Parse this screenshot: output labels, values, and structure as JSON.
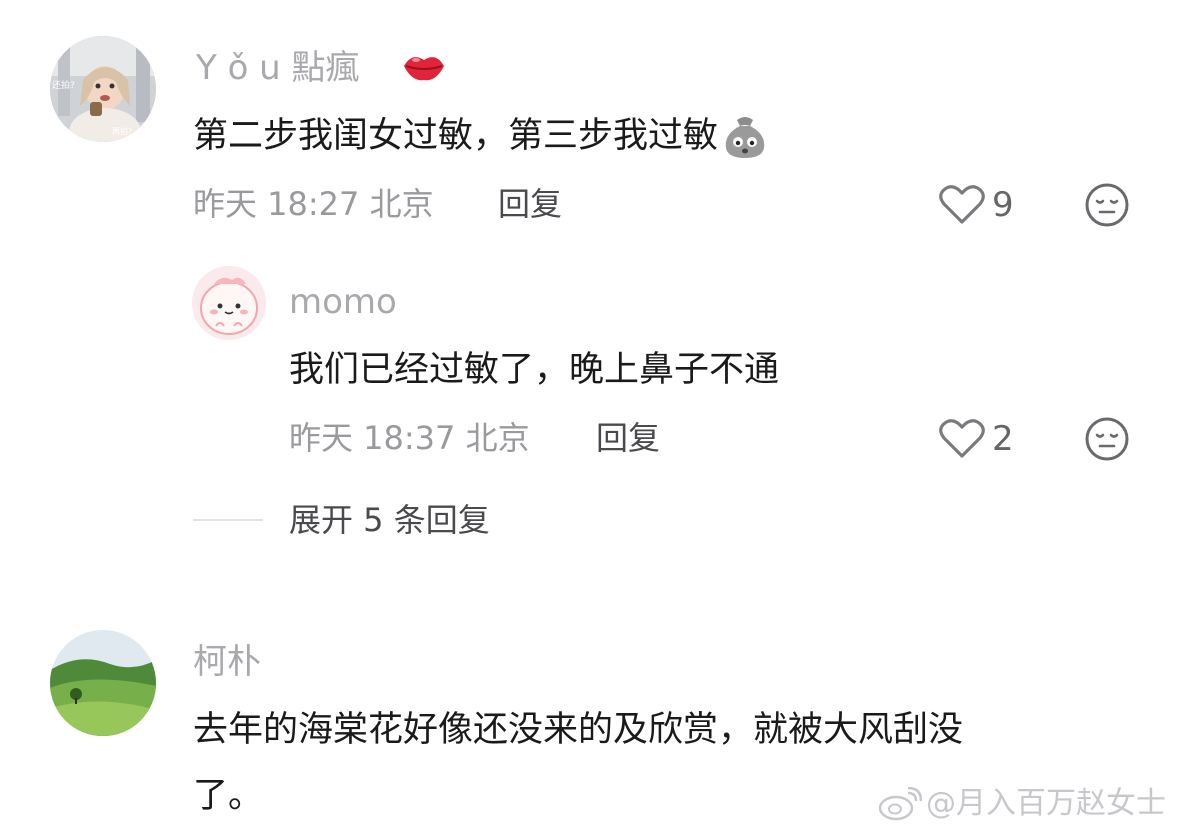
{
  "comments": [
    {
      "username": "Y ǒ u 點瘋",
      "badge_icon": "lips-emoji-icon",
      "text": "第二步我闺女过敏，第三步我过敏",
      "trailing_emoji": "money-bag-face-emoji-icon",
      "meta": "昨天 18:27 北京",
      "reply_label": "回复",
      "likes": "9",
      "accent": "#e0253a"
    },
    {
      "username": "momo",
      "text": "我们已经过敏了，晚上鼻子不通",
      "meta": "昨天 18:37 北京",
      "reply_label": "回复",
      "likes": "2"
    },
    {
      "username": "柯朴",
      "text_line1": "去年的海棠花好像还没来的及欣赏，就被大风刮没",
      "text_line2": "了。"
    }
  ],
  "expand_replies": "展开 5 条回复",
  "watermark": "@月入百万赵女士",
  "icons": [
    "heart-outline-icon",
    "dislike-face-icon",
    "weibo-logo-icon"
  ]
}
